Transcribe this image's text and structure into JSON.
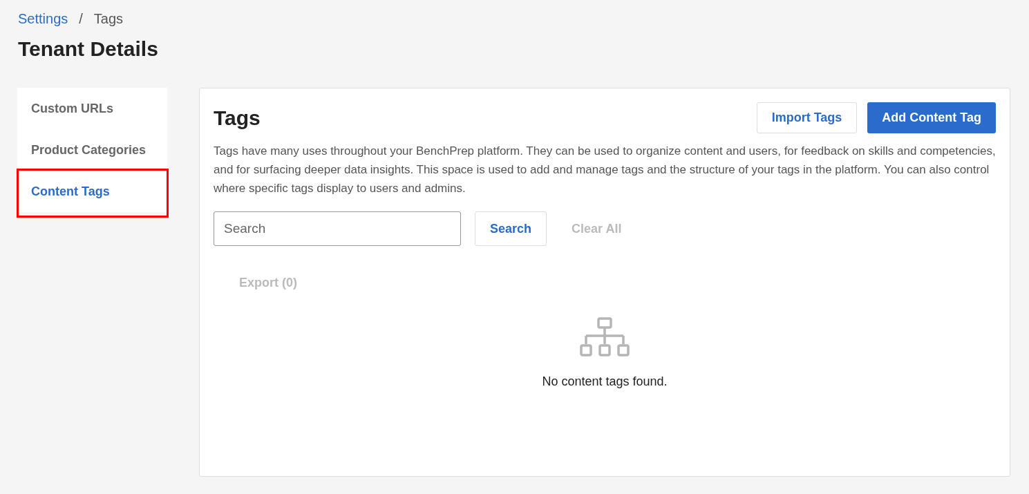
{
  "breadcrumb": {
    "separator": "/",
    "items": [
      {
        "label": "Settings",
        "kind": "link"
      },
      {
        "label": "Tags",
        "kind": "current"
      }
    ]
  },
  "page_title": "Tenant Details",
  "sidebar": {
    "items": [
      {
        "label": "Custom URLs",
        "selected": false,
        "highlighted": false
      },
      {
        "label": "Product Categories",
        "selected": false,
        "highlighted": false
      },
      {
        "label": "Content Tags",
        "selected": true,
        "highlighted": true
      }
    ]
  },
  "panel": {
    "title": "Tags",
    "buttons": [
      {
        "label": "Import Tags",
        "kind": "secondary"
      },
      {
        "label": "Add Content Tag",
        "kind": "primary"
      }
    ],
    "description": "Tags have many uses throughout your BenchPrep platform. They can be used to organize content and users, for feedback on skills and competencies, and for surfacing deeper data insights. This space is used to add and manage tags and the structure of your tags in the platform. You can also control where specific tags display to users and admins.",
    "search": {
      "placeholder": "Search",
      "button": "Search",
      "clear": {
        "label": "Clear All",
        "disabled": true
      }
    },
    "export": {
      "label": "Export (0)",
      "disabled": true
    },
    "empty_state": {
      "message": "No content tags found."
    }
  }
}
